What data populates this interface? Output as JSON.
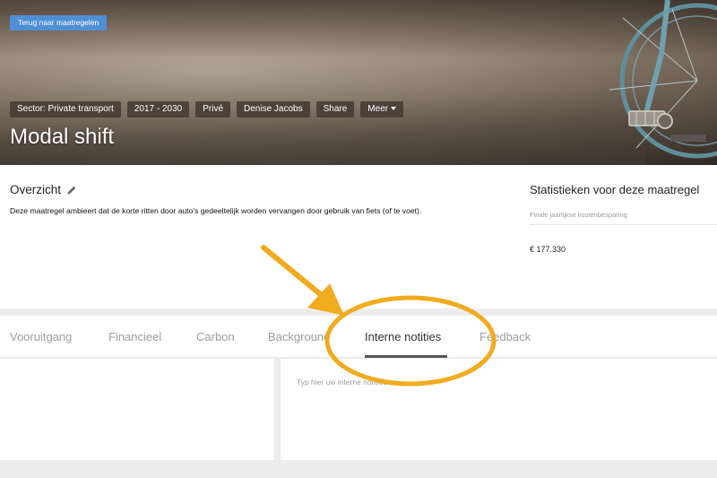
{
  "hero": {
    "back_button": "Terug naar maatregelen",
    "chips": [
      "Sector: Private transport",
      "2017 - 2030",
      "Privé",
      "Denise Jacobs",
      "Share"
    ],
    "more_button": "Meer",
    "title": "Modal shift"
  },
  "overview": {
    "title": "Overzicht",
    "description": "Deze maatregel ambieert dat de korte ritten door auto's gedeeltelijk worden vervangen door gebruik van fiets (of te voet)."
  },
  "stats": {
    "title": "Statistieken voor deze maatregel",
    "label": "Finale jaarlijkse kostenbesparing",
    "value": "€ 177.330"
  },
  "tabs": [
    "Vooruitgang",
    "Financieel",
    "Carbon",
    "Background",
    "Interne notities",
    "Feedback"
  ],
  "active_tab": "Interne notities",
  "notes": {
    "placeholder": "Typ hier uw interne notities"
  },
  "colors": {
    "accent": "#4f8fd6",
    "annotation": "#f0ab1e",
    "chip_bg": "#483e36"
  },
  "icons": {
    "edit": "pencil-icon",
    "more": "caret-down-icon"
  }
}
